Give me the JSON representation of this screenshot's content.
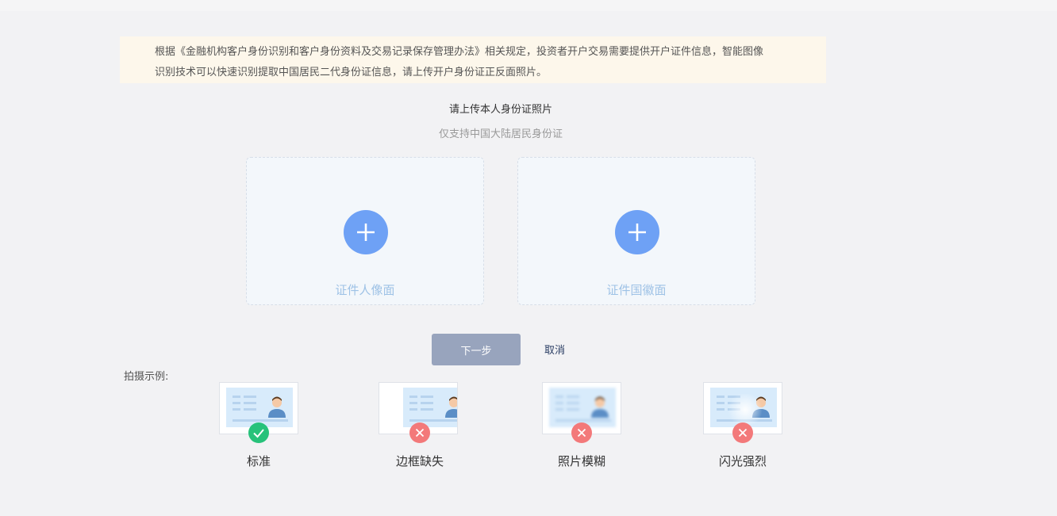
{
  "notice": {
    "line1": "根据《金融机构客户身份识别和客户身份资料及交易记录保存管理办法》相关规定，投资者开户交易需要提供开户证件信息，智能图像",
    "line2": "识别技术可以快速识别提取中国居民二代身份证信息，请上传开户身份证正反面照片。"
  },
  "upload": {
    "title": "请上传本人身份证照片",
    "subtitle": "仅支持中国大陆居民身份证",
    "front_label": "证件人像面",
    "back_label": "证件国徽面"
  },
  "actions": {
    "next_label": "下一步",
    "cancel_label": "取消"
  },
  "examples": {
    "label": "拍摄示例:",
    "items": [
      {
        "caption": "标准",
        "status": "ok"
      },
      {
        "caption": "边框缺失",
        "status": "error"
      },
      {
        "caption": "照片模糊",
        "status": "error"
      },
      {
        "caption": "闪光强烈",
        "status": "error"
      }
    ]
  },
  "colors": {
    "accent_blue": "#6ea1f5",
    "ok_green": "#27c27a",
    "error_red": "#f3797a",
    "button_gray": "#98a4bd"
  }
}
